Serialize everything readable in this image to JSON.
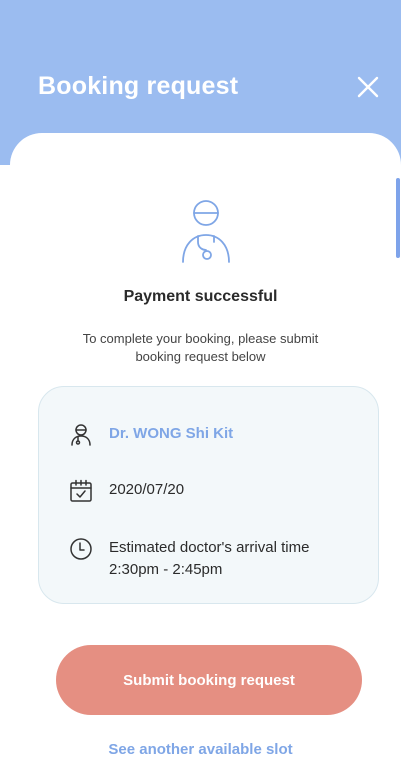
{
  "header": {
    "title": "Booking request",
    "close_icon": "close-icon"
  },
  "status": {
    "icon": "doctor-icon",
    "title": "Payment successful",
    "message": "To complete your booking, please submit booking request below"
  },
  "card": {
    "doctor_name": "Dr. WONG Shi Kit",
    "doctor_icon": "doctor-icon",
    "date": "2020/07/20",
    "date_icon": "calendar-icon",
    "arrival_label": "Estimated doctor's arrival time",
    "arrival_time": "2:30pm - 2:45pm",
    "time_icon": "clock-icon"
  },
  "actions": {
    "submit_label": "Submit booking request",
    "another_slot_label": "See another available slot"
  },
  "colors": {
    "header_bg": "#9bbcf0",
    "accent_blue": "#7fa6e6",
    "submit_bg": "#e58f82",
    "card_bg": "#f3f8fa"
  }
}
